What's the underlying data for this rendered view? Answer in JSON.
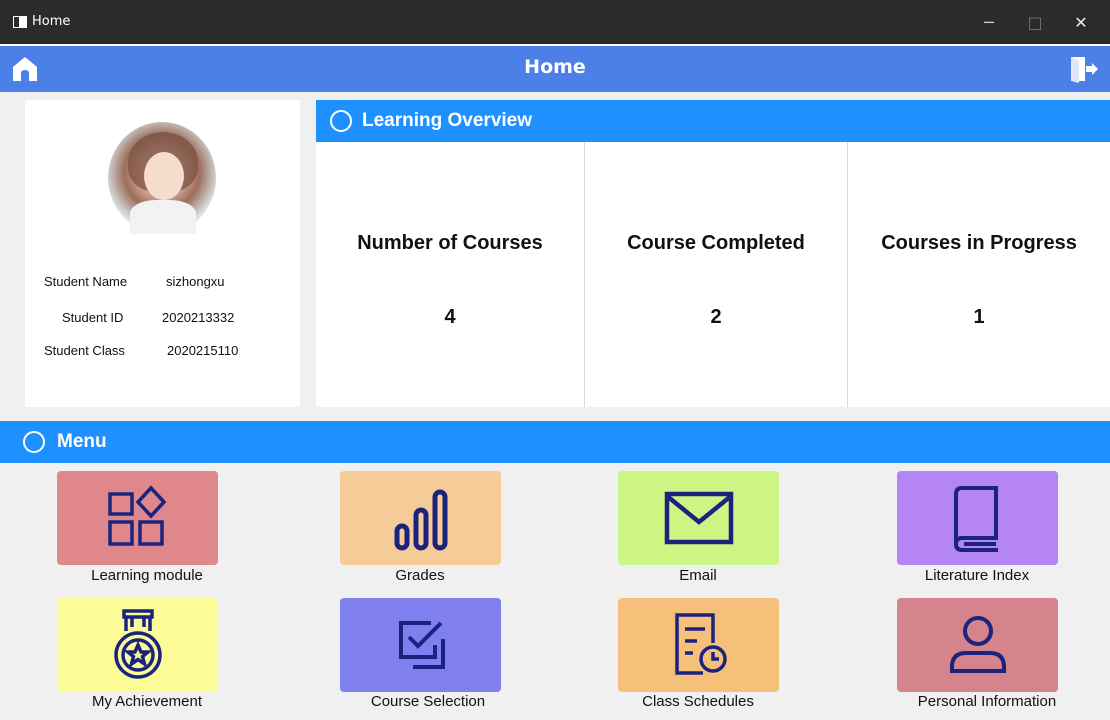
{
  "window": {
    "title": "Home",
    "minimize": "─",
    "maximize": "□",
    "close": "✕"
  },
  "appbar": {
    "title": "Home",
    "home_icon": "home-icon",
    "exit_icon": "exit-icon"
  },
  "profile": {
    "fields": [
      {
        "label": "Student Name",
        "value": "sizhongxu"
      },
      {
        "label": "Student ID",
        "value": "2020213332"
      },
      {
        "label": "Student Class",
        "value": "2020215110"
      }
    ]
  },
  "overview": {
    "title": "Learning Overview",
    "stats": [
      {
        "label": "Number of Courses",
        "value": "4"
      },
      {
        "label": "Course Completed",
        "value": "2"
      },
      {
        "label": "Courses in Progress",
        "value": "1"
      }
    ]
  },
  "menu": {
    "title": "Menu",
    "items": [
      {
        "label": "Learning module",
        "icon": "grid-modules-icon",
        "color": "#e0878c"
      },
      {
        "label": "Grades",
        "icon": "bar-chart-icon",
        "color": "#f5cc97"
      },
      {
        "label": "Email",
        "icon": "envelope-icon",
        "color": "#ccf584"
      },
      {
        "label": "Literature Index",
        "icon": "book-icon",
        "color": "#b585f5"
      },
      {
        "label": "My Achievement",
        "icon": "medal-icon",
        "color": "#fbfb98"
      },
      {
        "label": "Course Selection",
        "icon": "checkbox-icon",
        "color": "#7f7ff0"
      },
      {
        "label": "Class Schedules",
        "icon": "schedule-icon",
        "color": "#f5c07a"
      },
      {
        "label": "Personal Information",
        "icon": "person-icon",
        "color": "#d4848a"
      }
    ]
  },
  "colors": {
    "accent": "#1e90ff",
    "header": "#4d7fe9",
    "icon_stroke": "#1a237e"
  }
}
